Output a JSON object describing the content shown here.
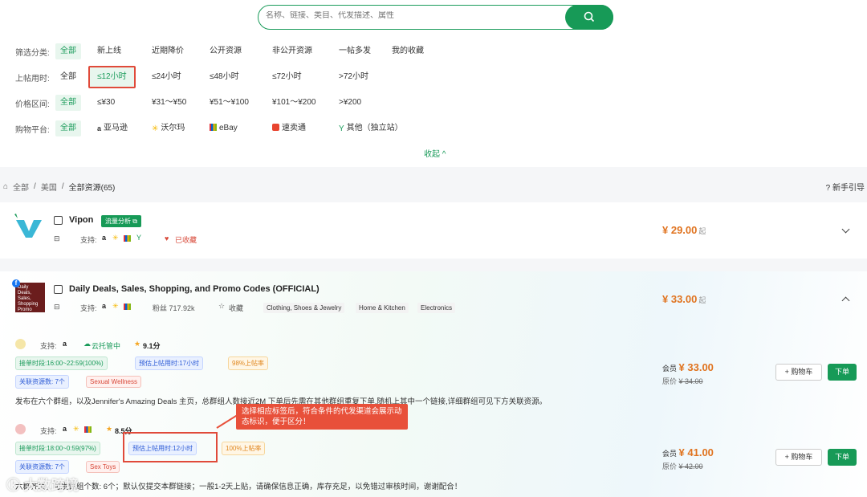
{
  "search": {
    "placeholder": "名称、链接、类目、代发描述、属性"
  },
  "filters": {
    "category": {
      "label": "筛选分类:",
      "options": [
        "全部",
        "新上线",
        "近期降价",
        "公开资源",
        "非公开资源",
        "一帖多发",
        "我的收藏"
      ]
    },
    "post_time": {
      "label": "上帖用时:",
      "options": [
        "全部",
        "≤12小时",
        "≤24小时",
        "≤48小时",
        "≤72小时",
        ">72小时"
      ]
    },
    "price": {
      "label": "价格区间:",
      "options": [
        "全部",
        "≤¥30",
        "¥31～¥50",
        "¥51～¥100",
        "¥101～¥200",
        ">¥200"
      ]
    },
    "platform": {
      "label": "购物平台:",
      "options": [
        "全部",
        "亚马逊",
        "沃尔玛",
        "eBay",
        "速卖通",
        "其他（独立站）"
      ]
    },
    "collapse": "收起 ^"
  },
  "breadcrumb": {
    "all": "全部",
    "region": "美国",
    "current": "全部资源(65)"
  },
  "guide": "新手引导",
  "vipon": {
    "name": "Vipon",
    "traffic_btn": "流量分析",
    "support": "支持:",
    "favorited": "已收藏",
    "price": "¥ 29.00",
    "price_suffix": "起"
  },
  "dailydeals": {
    "name": "Daily Deals, Sales, Shopping, and Promo Codes (OFFICIAL)",
    "logo_text": "Daily Deals, Sales, Shopping Promo Code",
    "support": "支持:",
    "fans": "粉丝 717.92k",
    "favorite": "收藏",
    "tags": [
      "Clothing, Shoes & Jewelry",
      "Home & Kitchen",
      "Electronics"
    ],
    "price": "¥ 33.00",
    "price_suffix": "起"
  },
  "listing1": {
    "support": "支持:",
    "hosted": "云托管中",
    "score": "9.1分",
    "order_time": "接单时段:16:00~22:59(100%)",
    "est_time": "预估上帖用时:17小时",
    "post_rate": "98%上帖率",
    "related": "关联资源数: 7个",
    "category": "Sexual Wellness",
    "desc": "发布在六个群组，以及Jennifer's Amazing Deals 主页，总群组人数接近2M 下单后先需在其他群组重复下单,随机上其中一个链接,详细群组可见下方关联资源。",
    "member_label": "会员",
    "member_price": "¥ 33.00",
    "orig_label": "原价",
    "orig_price": "¥ 34.00",
    "cart": "购物车",
    "order": "下单"
  },
  "listing2": {
    "support": "支持:",
    "score": "8.5分",
    "order_time": "接单时段:18:00~0:59(97%)",
    "est_time": "预估上帖用时:12小时",
    "post_rate": "100%上帖率",
    "related": "关联资源数: 7个",
    "category": "Sex Toys",
    "desc": "六群齐发，可发群组个数: 6个；默认仅提交本群链接；一般1-2天上贴，请确保信息正确，库存充足，以免错过审核时间，谢谢配合！",
    "member_label": "会员",
    "member_price": "¥ 41.00",
    "orig_label": "原价",
    "orig_price": "¥ 42.00",
    "cart": "购物车",
    "order": "下单"
  },
  "callout": "选择相应标签后，符合条件的代发渠道会展示动态标识，便于区分！",
  "watermark": "大数跨境",
  "colors": {
    "brand_green": "#179a57",
    "price_orange": "#e0731f",
    "annotation_red": "#e04a3a"
  }
}
